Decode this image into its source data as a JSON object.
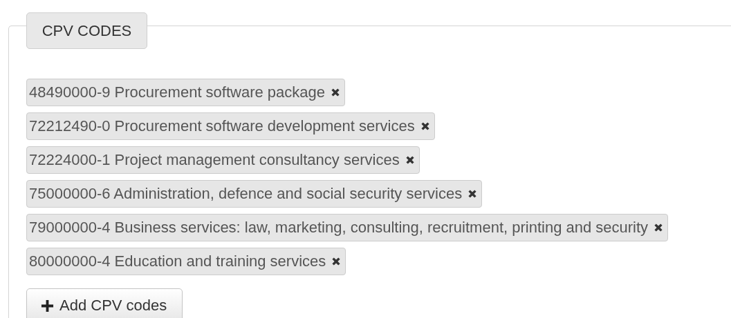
{
  "section": {
    "legend": "CPV CODES"
  },
  "codes": [
    {
      "label": "48490000-9 Procurement software package"
    },
    {
      "label": "72212490-0 Procurement software development services"
    },
    {
      "label": "72224000-1 Project management consultancy services"
    },
    {
      "label": "75000000-6 Administration, defence and social security services"
    },
    {
      "label": "79000000-4 Business services: law, marketing, consulting, recruitment, printing and security"
    },
    {
      "label": "80000000-4 Education and training services"
    }
  ],
  "add_button": {
    "label": "Add CPV codes"
  }
}
